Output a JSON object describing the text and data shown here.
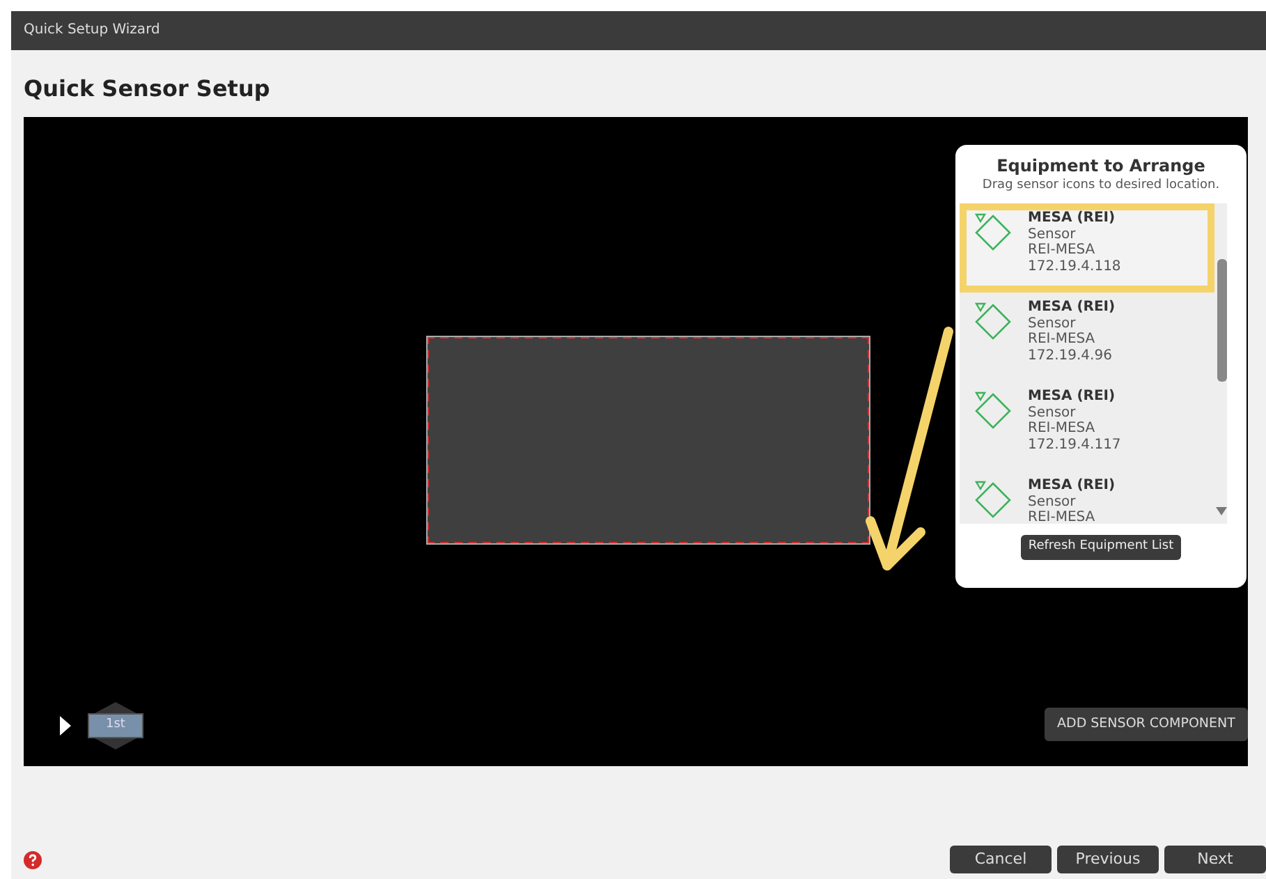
{
  "window": {
    "title": "Quick Setup Wizard"
  },
  "heading": "Quick Sensor Setup",
  "equipment_panel": {
    "title": "Equipment to Arrange",
    "subtitle": "Drag sensor icons to desired location.",
    "items": [
      {
        "name": "MESA (REI)",
        "type": "Sensor",
        "device": "REI-MESA",
        "ip": "172.19.4.118",
        "highlighted": true
      },
      {
        "name": "MESA (REI)",
        "type": "Sensor",
        "device": "REI-MESA",
        "ip": "172.19.4.96",
        "highlighted": false
      },
      {
        "name": "MESA (REI)",
        "type": "Sensor",
        "device": "REI-MESA",
        "ip": "172.19.4.117",
        "highlighted": false
      },
      {
        "name": "MESA (REI)",
        "type": "Sensor",
        "device": "REI-MESA",
        "highlighted": false
      }
    ],
    "refresh_button": "Refresh Equipment List"
  },
  "floor_selector": {
    "floors": [
      {
        "label": "1st",
        "selected": true
      }
    ]
  },
  "add_button": "ADD SENSOR COMPONENT",
  "footer_buttons": [
    "Cancel",
    "Previous",
    "Next"
  ]
}
